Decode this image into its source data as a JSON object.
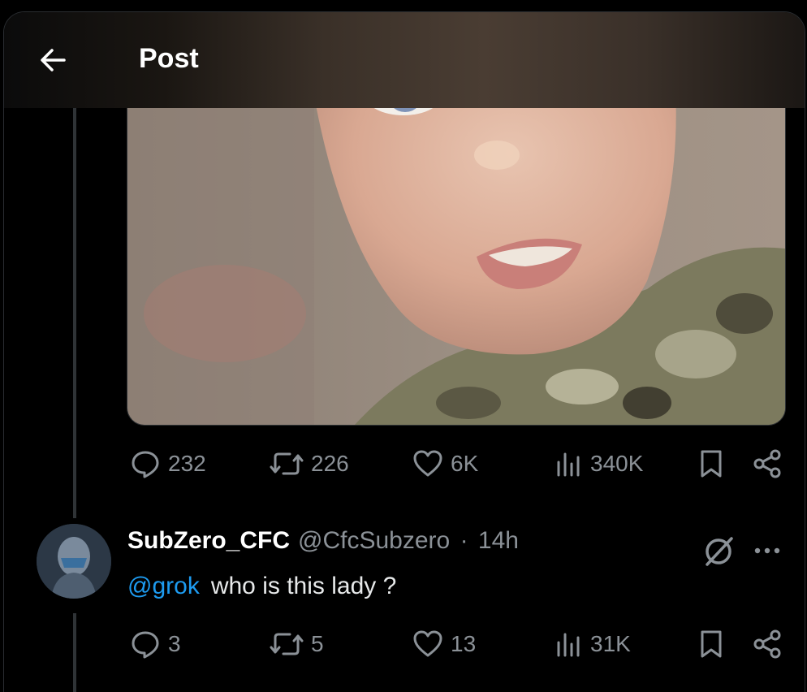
{
  "header": {
    "title": "Post",
    "back_icon": "arrow-left-icon"
  },
  "post": {
    "media_alt": "video still",
    "stats": {
      "replies": "232",
      "reposts": "226",
      "likes": "6K",
      "views": "340K"
    }
  },
  "reply": {
    "display_name": "SubZero_CFC",
    "handle": "@CfcSubzero",
    "separator": "·",
    "time": "14h",
    "mention": "@grok",
    "text": "who is this lady ?",
    "stats": {
      "replies": "3",
      "reposts": "5",
      "likes": "13",
      "views": "31K"
    }
  },
  "colors": {
    "accent": "#1d9bf0",
    "muted": "#8b9197",
    "background": "#000000"
  }
}
